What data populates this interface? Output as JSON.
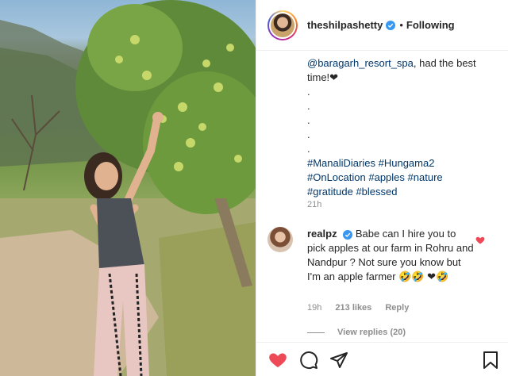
{
  "post": {
    "username": "theshilpashetty",
    "follow_status": "Following",
    "separator": "•"
  },
  "caption": {
    "mention": "@baragarh_resort_spa",
    "text_after_mention": ", had the best time!❤",
    "dots": [
      ".",
      ".",
      ".",
      ".",
      "."
    ],
    "hashtag_lines": [
      [
        "#ManaliDiaries",
        "#Hungama2"
      ],
      [
        "#OnLocation",
        "#apples",
        "#nature"
      ],
      [
        "#gratitude",
        "#blessed"
      ]
    ],
    "time": "21h"
  },
  "comment": {
    "username": "realpz",
    "text": "Babe can I hire you to pick apples at our farm in Rohru and Nandpur ? Not sure you know but I'm an apple farmer 🤣🤣 ❤🤣",
    "time": "19h",
    "likes": "213 likes",
    "reply": "Reply",
    "view_replies": "View replies (20)"
  },
  "colors": {
    "like_red": "#ed4956",
    "verified_blue": "#3897f0",
    "link_blue": "#00376b"
  },
  "icons": [
    "heart-filled-icon",
    "comment-icon",
    "share-icon",
    "bookmark-icon",
    "verified-badge-icon",
    "comment-like-heart-icon"
  ]
}
